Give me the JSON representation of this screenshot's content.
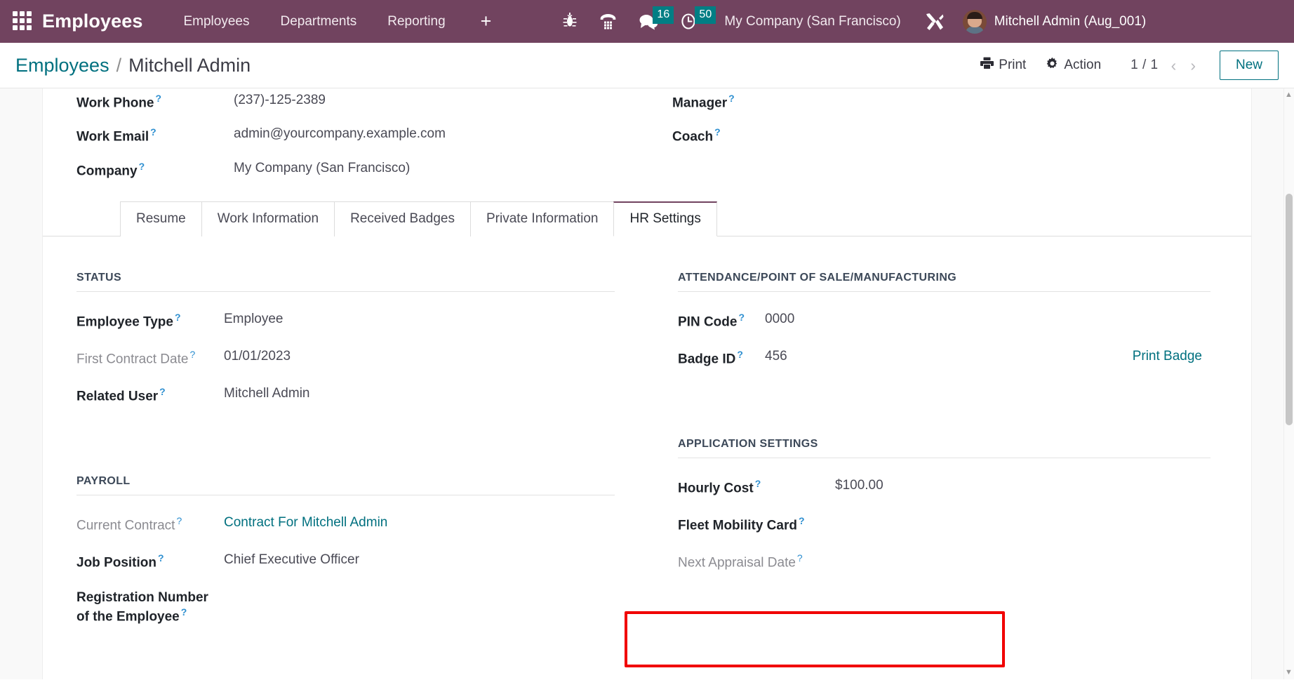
{
  "navbar": {
    "apps_icon": "apps-grid-icon",
    "brand": "Employees",
    "menu": [
      {
        "label": "Employees"
      },
      {
        "label": "Departments"
      },
      {
        "label": "Reporting"
      }
    ],
    "plus_label": "+",
    "icons": [
      {
        "name": "bug-icon",
        "badge": ""
      },
      {
        "name": "dialpad-icon",
        "badge": ""
      },
      {
        "name": "messages-icon",
        "badge": "16"
      },
      {
        "name": "activities-clock-icon",
        "badge": "50"
      }
    ],
    "company": "My Company (San Francisco)",
    "tools_icon": "wrench-screwdriver-icon",
    "user": "Mitchell Admin (Aug_001)",
    "accent_color": "#71435f",
    "badge_color": "#017e84"
  },
  "control_panel": {
    "breadcrumb_root": "Employees",
    "breadcrumb_sep": "/",
    "breadcrumb_current": "Mitchell Admin",
    "print_label": "Print",
    "action_label": "Action",
    "pager": "1 / 1",
    "prev_arrow": "‹",
    "next_arrow": "›",
    "new_label": "New"
  },
  "top_fields": {
    "left": [
      {
        "label": "Work Phone",
        "value": "(237)-125-2389",
        "help": "?",
        "muted": false
      },
      {
        "label": "Work Email",
        "value": "admin@yourcompany.example.com",
        "help": "?",
        "muted": false
      },
      {
        "label": "Company",
        "value": "My Company (San Francisco)",
        "help": "?",
        "muted": false
      }
    ],
    "right": [
      {
        "label": "Manager",
        "value": "",
        "help": "?",
        "muted": false
      },
      {
        "label": "Coach",
        "value": "",
        "help": "?",
        "muted": false
      }
    ]
  },
  "tabs": [
    {
      "label": "Resume",
      "active": false
    },
    {
      "label": "Work Information",
      "active": false
    },
    {
      "label": "Received Badges",
      "active": false
    },
    {
      "label": "Private Information",
      "active": false
    },
    {
      "label": "HR Settings",
      "active": true
    }
  ],
  "hr_settings": {
    "status": {
      "title": "STATUS",
      "rows": [
        {
          "label": "Employee Type",
          "value": "Employee",
          "help": "?",
          "muted_label": false,
          "link": false
        },
        {
          "label": "First Contract Date",
          "value": "01/01/2023",
          "help": "?",
          "muted_label": true,
          "link": false
        },
        {
          "label": "Related User",
          "value": "Mitchell Admin",
          "help": "?",
          "muted_label": false,
          "link": false
        }
      ]
    },
    "attendance": {
      "title": "ATTENDANCE/POINT OF SALE/MANUFACTURING",
      "rows": [
        {
          "label": "PIN Code",
          "value": "0000",
          "help": "?",
          "muted_label": false,
          "link": false,
          "action": ""
        },
        {
          "label": "Badge ID",
          "value": "456",
          "help": "?",
          "muted_label": false,
          "link": false,
          "action": "Print Badge"
        }
      ]
    },
    "payroll": {
      "title": "PAYROLL",
      "rows": [
        {
          "label": "Current Contract",
          "value": "Contract For Mitchell Admin",
          "help": "?",
          "muted_label": true,
          "link": true
        },
        {
          "label": "Job Position",
          "value": "Chief Executive Officer",
          "help": "?",
          "muted_label": false,
          "link": false
        },
        {
          "label": "Registration Number of the Employee",
          "value": "",
          "help": "?",
          "muted_label": false,
          "link": false
        }
      ]
    },
    "application_settings": {
      "title": "APPLICATION SETTINGS",
      "rows": [
        {
          "label": "Hourly Cost",
          "value": "$100.00",
          "help": "?",
          "muted_label": false,
          "link": false,
          "highlighted": true
        },
        {
          "label": "Fleet Mobility Card",
          "value": "",
          "help": "?",
          "muted_label": false,
          "link": false,
          "highlighted": false
        },
        {
          "label": "Next Appraisal Date",
          "value": "",
          "help": "?",
          "muted_label": true,
          "link": false,
          "highlighted": false
        }
      ]
    }
  },
  "annotation": {
    "highlight_color": "#f10000",
    "target": "Hourly Cost"
  }
}
